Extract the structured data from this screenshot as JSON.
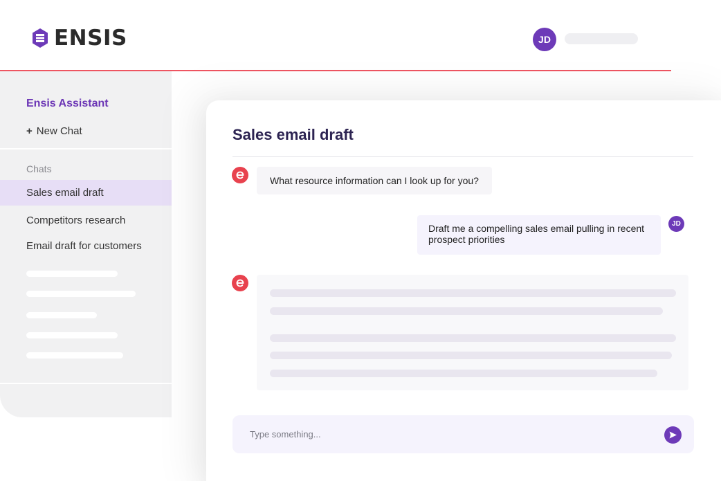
{
  "header": {
    "brand": "ENSIS",
    "user_initials": "JD"
  },
  "sidebar": {
    "title": "Ensis Assistant",
    "new_chat_icon": "+",
    "new_chat_label": "New Chat",
    "chats_label": "Chats",
    "items": [
      {
        "label": "Sales email draft",
        "active": true
      },
      {
        "label": "Competitors research",
        "active": false
      },
      {
        "label": "Email draft for customers",
        "active": false
      }
    ]
  },
  "chat": {
    "title": "Sales email draft",
    "messages": [
      {
        "role": "assistant",
        "text": "What resource information can I look up for you?"
      },
      {
        "role": "user",
        "initials": "JD",
        "text": "Draft me a compelling sales email pulling in recent prospect priorities"
      },
      {
        "role": "assistant",
        "status": "loading"
      }
    ],
    "composer": {
      "placeholder": "Type something...",
      "send_icon": "send-icon"
    }
  },
  "colors": {
    "brand_purple": "#6b35b5",
    "accent_red": "#e8424e",
    "sidebar_bg": "#f1f1f2",
    "active_item_bg": "#e7def6"
  }
}
